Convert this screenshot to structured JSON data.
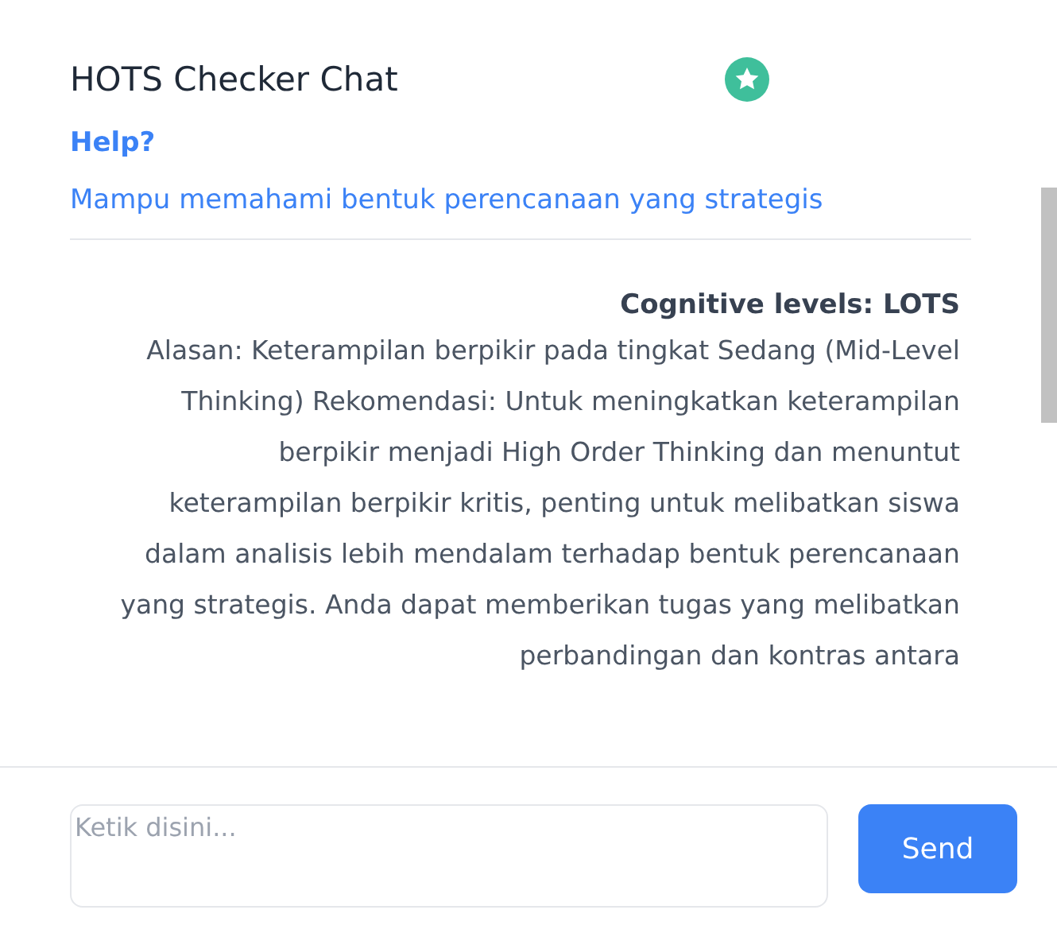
{
  "header": {
    "title": "HOTS Checker Chat",
    "help": "Help?"
  },
  "objective": "Mampu memahami bentuk perencanaan yang strategis",
  "messages": [
    {
      "heading": "Cognitive levels: LOTS",
      "body": "Alasan: Keterampilan berpikir pada tingkat Sedang (Mid-Level Thinking) Rekomendasi: Untuk meningkatkan keterampilan berpikir menjadi High Order Thinking dan menuntut keterampilan berpikir kritis, penting untuk melibatkan siswa dalam analisis lebih mendalam terhadap bentuk perencanaan yang strategis. Anda dapat memberikan tugas yang melibatkan perbandingan dan kontras antara"
    }
  ],
  "composer": {
    "placeholder": "Ketik disini...",
    "send": "Send"
  }
}
